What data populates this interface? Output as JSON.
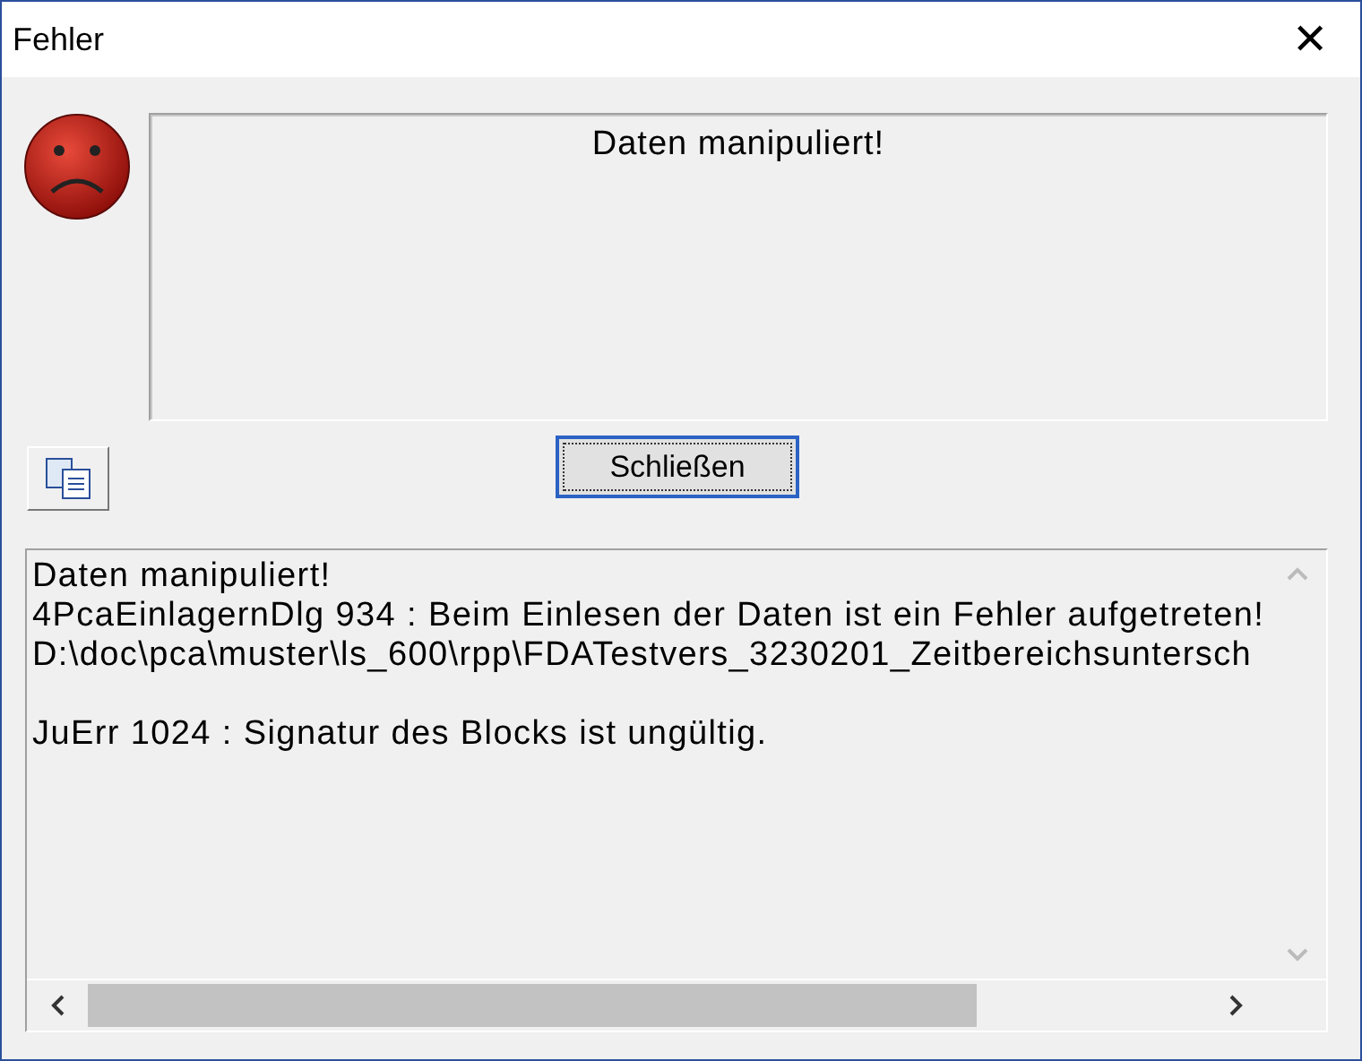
{
  "window": {
    "title": "Fehler",
    "close": "✕"
  },
  "message": "Daten manipuliert!",
  "button": "Schließen",
  "details": [
    [
      "Daten manipuliert!",
      "4PcaEinlagernDlg 934 : Beim Einlesen der Daten ist ein Fehler aufgetreten!",
      "D:\\doc\\pca\\muster\\ls_600\\rpp\\FDATestvers_3230201_Zeitbereichsuntersch"
    ],
    [
      "JuErr 1024 : Signatur des Blocks ist ungültig."
    ]
  ]
}
